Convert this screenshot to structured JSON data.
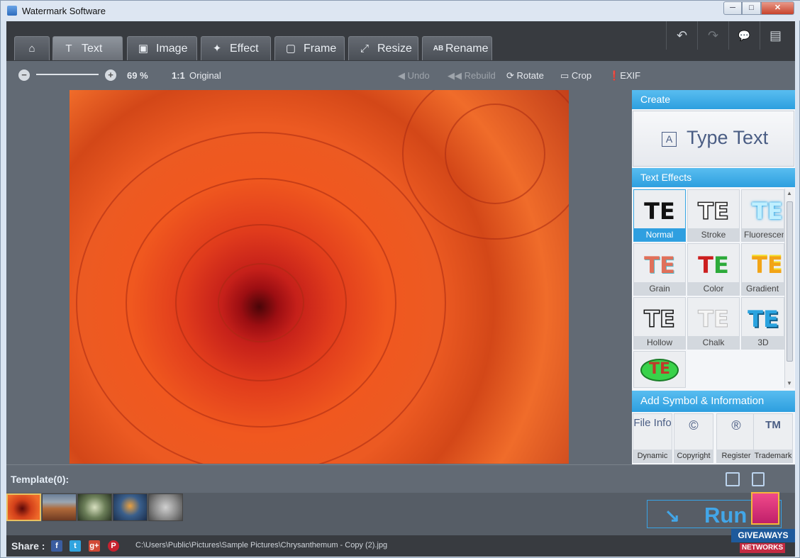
{
  "window": {
    "title": "Watermark Software",
    "minimize_glyph": "─",
    "maximize_glyph": "□",
    "close_glyph": "✕"
  },
  "tabs": [
    {
      "label": "",
      "icon": "home-icon",
      "glyph": "⌂",
      "active": false
    },
    {
      "label": "Text",
      "icon": "text-icon",
      "glyph": "T",
      "active": true
    },
    {
      "label": "Image",
      "icon": "image-icon",
      "glyph": "▣",
      "active": false
    },
    {
      "label": "Effect",
      "icon": "magic-wand-icon",
      "glyph": "✦",
      "active": false
    },
    {
      "label": "Frame",
      "icon": "frame-icon",
      "glyph": "▢",
      "active": false
    },
    {
      "label": "Resize",
      "icon": "resize-icon",
      "glyph": "⤢",
      "active": false
    },
    {
      "label": "Rename",
      "icon": "rename-icon",
      "glyph": "AB",
      "active": false
    }
  ],
  "top_actions": [
    {
      "icon": "undo-icon",
      "glyph": "↶"
    },
    {
      "icon": "redo-icon",
      "glyph": "↷"
    },
    {
      "icon": "message-icon",
      "glyph": "💬"
    },
    {
      "icon": "document-icon",
      "glyph": "▤"
    }
  ],
  "toolbar": {
    "zoom_value": "69 %",
    "zoom_level": 0.69,
    "original_icon": "1:1",
    "original_label": "Original",
    "undo_label": "Undo",
    "rebuild_label": "Rebuild",
    "rotate_label": "Rotate",
    "crop_label": "Crop",
    "exif_label": "EXIF"
  },
  "panel": {
    "create_title": "Create",
    "type_text_label": "Type Text",
    "type_text_icon": "A",
    "effects_title": "Text Effects",
    "effect_sample": "TE",
    "effects": [
      {
        "label": "Normal",
        "style": "normal",
        "selected": true
      },
      {
        "label": "Stroke",
        "style": "stroke",
        "selected": false
      },
      {
        "label": "Fluorescent",
        "style": "fluorescent",
        "selected": false
      },
      {
        "label": "Grain",
        "style": "grain",
        "selected": false
      },
      {
        "label": "Color",
        "style": "color",
        "selected": false
      },
      {
        "label": "Gradient",
        "style": "gradient",
        "selected": false
      },
      {
        "label": "Hollow",
        "style": "hollow",
        "selected": false
      },
      {
        "label": "Chalk",
        "style": "chalk",
        "selected": false
      },
      {
        "label": "3D",
        "style": "3d",
        "selected": false
      },
      {
        "label": "",
        "style": "badge",
        "selected": false
      }
    ],
    "symbol_title": "Add Symbol & Information",
    "symbols": [
      {
        "icon_text": "File Info",
        "label": "Dynamic"
      },
      {
        "icon_text": "©",
        "label": "Copyright"
      },
      {
        "icon_text": "®",
        "label": "Register"
      },
      {
        "icon_text": "TM",
        "label": "Trademark"
      }
    ]
  },
  "template": {
    "label": "Template(0):"
  },
  "run": {
    "label": "Run"
  },
  "status": {
    "share_label": "Share :",
    "path": "C:\\Users\\Public\\Pictures\\Sample Pictures\\Chrysanthemum - Copy (2).jpg"
  },
  "promo": {
    "line1": "GIVEAWAYS",
    "line2": "NETWORKS"
  },
  "colors": {
    "accent": "#2d9fdf",
    "tab_bar": "#383b40",
    "canvas_bg": "#626a74",
    "run_accent": "#42a6e8"
  }
}
